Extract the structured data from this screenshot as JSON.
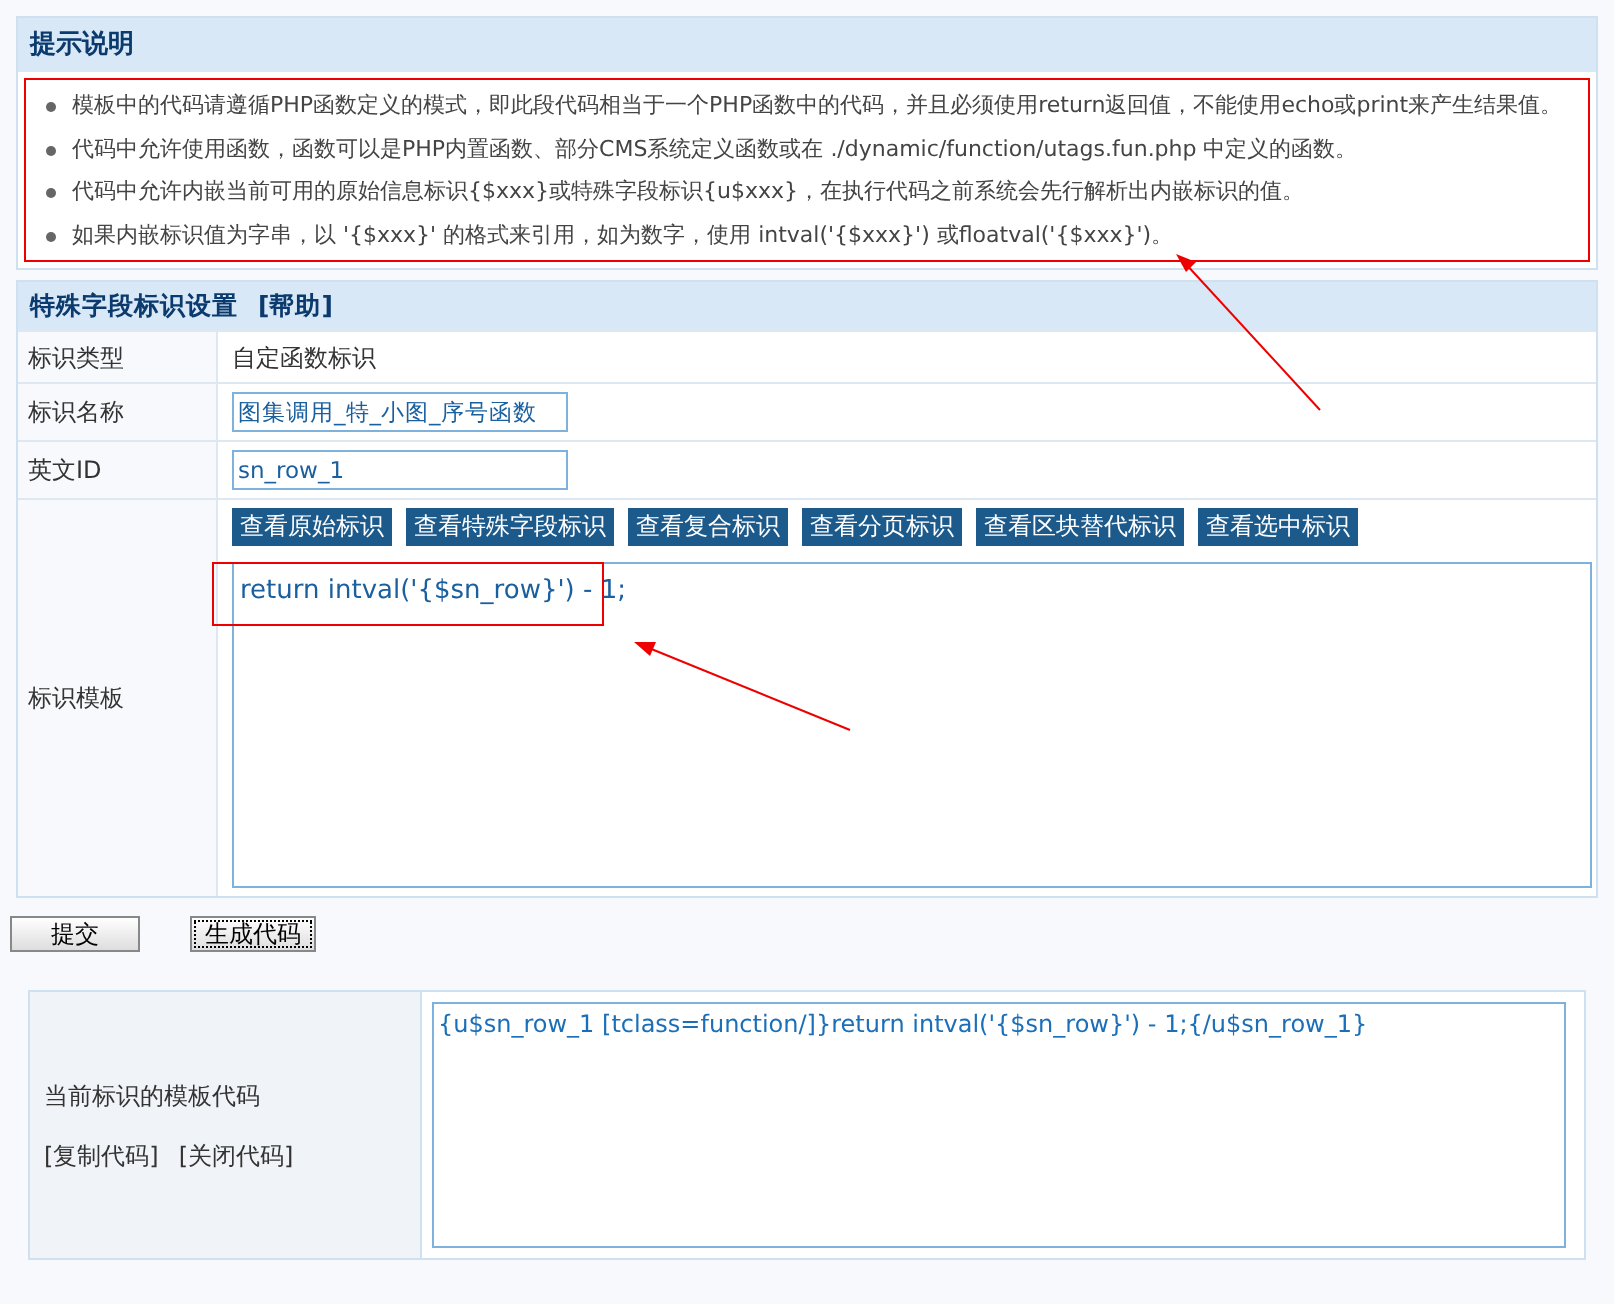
{
  "tips": {
    "title": "提示说明",
    "items": [
      "模板中的代码请遵循PHP函数定义的模式，即此段代码相当于一个PHP函数中的代码，并且必须使用return返回值，不能使用echo或print来产生结果值。",
      "代码中允许使用函数，函数可以是PHP内置函数、部分CMS系统定义函数或在 ./dynamic/function/utags.fun.php 中定义的函数。",
      "代码中允许内嵌当前可用的原始信息标识{$xxx}或特殊字段标识{u$xxx}，在执行代码之前系统会先行解析出内嵌标识的值。",
      "如果内嵌标识值为字串，以 '{$xxx}' 的格式来引用，如为数字，使用  intval('{$xxx}') 或floatval('{$xxx}')。"
    ]
  },
  "form": {
    "title": "特殊字段标识设置",
    "help_link": "[帮助]",
    "rows": [
      {
        "kind": "text",
        "label": "标识类型",
        "value": "自定函数标识"
      },
      {
        "kind": "input",
        "label": "标识名称",
        "value": "图集调用_特_小图_序号函数"
      },
      {
        "kind": "input",
        "label": "英文ID",
        "value": "sn_row_1"
      },
      {
        "kind": "template",
        "label": "标识模板",
        "buttons": [
          "查看原始标识",
          "查看特殊字段标识",
          "查看复合标识",
          "查看分页标识",
          "查看区块替代标识",
          "查看选中标识"
        ],
        "value": "return intval('{$sn_row}') - 1;"
      }
    ]
  },
  "actions": [
    {
      "label": "提交",
      "focused": false
    },
    {
      "label": "生成代码",
      "focused": true
    }
  ],
  "code_panel": {
    "label": "当前标识的模板代码",
    "links": [
      "[复制代码]",
      "[关闭代码]"
    ],
    "value": "{u$sn_row_1 [tclass=function/]}return intval('{$sn_row}') - 1;{/u$sn_row_1}"
  }
}
